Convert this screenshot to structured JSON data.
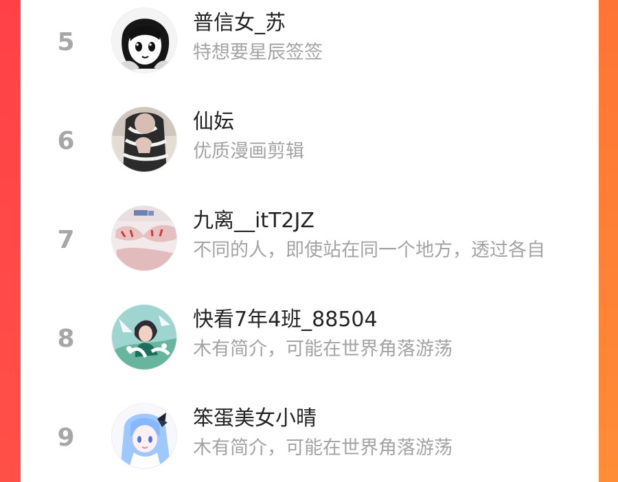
{
  "ranking": {
    "items": [
      {
        "rank": "5",
        "name": "普信女_苏",
        "bio": "特想要星辰签签",
        "avatar": "manga-girl-avatar"
      },
      {
        "rank": "6",
        "name": "仙妘",
        "bio": "优质漫画剪辑",
        "avatar": "photo-person-avatar"
      },
      {
        "rank": "7",
        "name": "九离__itT2JZ",
        "bio": "不同的人，即使站在同一个地方，透过各自",
        "avatar": "hands-photo-avatar"
      },
      {
        "rank": "8",
        "name": "快看7年4班_88504",
        "bio": "木有简介，可能在世界角落游荡",
        "avatar": "anime-character-avatar"
      },
      {
        "rank": "9",
        "name": "笨蛋美女小晴",
        "bio": "木有简介，可能在世界角落游荡",
        "avatar": "blue-hair-anime-avatar"
      }
    ]
  },
  "colors": {
    "background_left": "#ff4147",
    "background_right": "#ff8c37",
    "rank_gray": "#a7a7a7",
    "name_dark": "#222222",
    "bio_gray": "#a3a3a3"
  }
}
